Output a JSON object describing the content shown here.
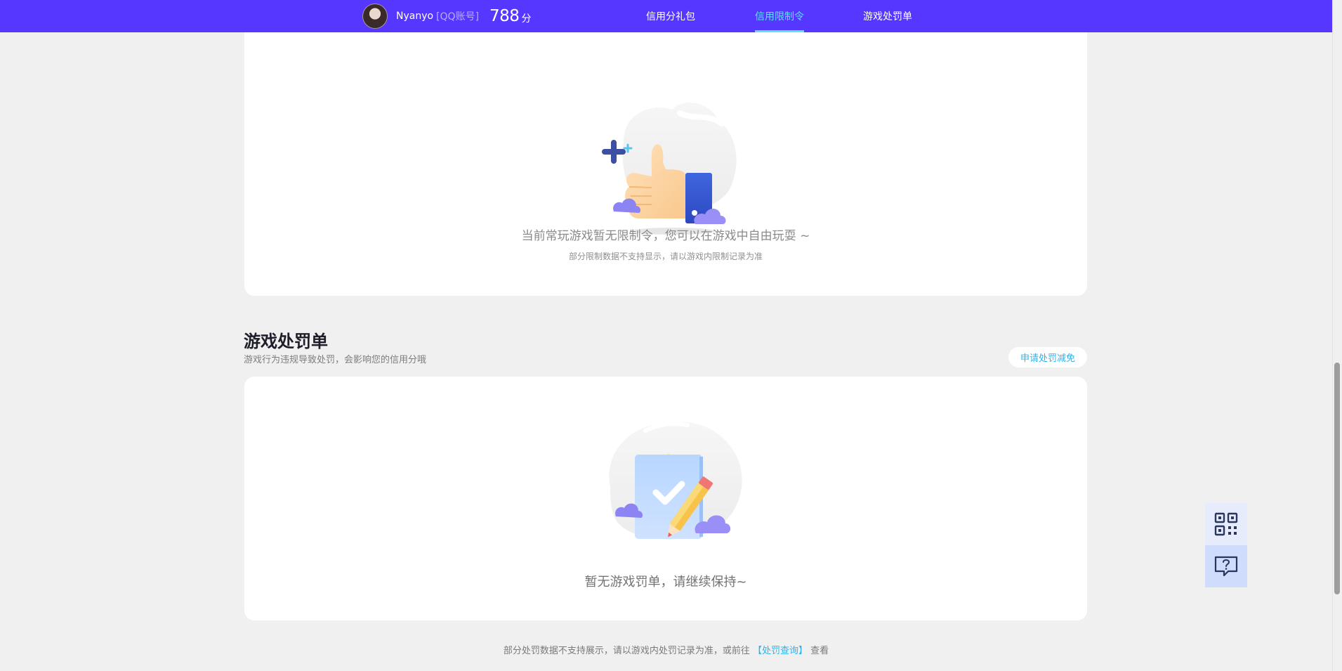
{
  "header": {
    "username": "Nyanyo",
    "account_type": "[QQ账号]",
    "score": "788",
    "score_unit": "分",
    "nav": [
      "信用分礼包",
      "信用限制令",
      "游戏处罚单"
    ],
    "active_nav": "信用限制令",
    "accent": "#5537ff",
    "active_color": "#5fe0ff"
  },
  "restriction": {
    "empty_text": "当前常玩游戏暂无限制令，您可以在游戏中自由玩耍 ~",
    "note": "部分限制数据不支持显示，请以游戏内限制记录为准"
  },
  "penalty": {
    "title": "游戏处罚单",
    "description": "游戏行为违规导致处罚，会影响您的信用分哦",
    "apply_button": "申请处罚减免",
    "empty_text": "暂无游戏罚单，请继续保持~"
  },
  "footer": {
    "text_before": "部分处罚数据不支持展示，请以游戏内处罚记录为准，或前往",
    "link": "【处罚查询】",
    "text_after": "查看",
    "link_color": "#2db3ea"
  },
  "side_buttons": [
    "qr-code-icon",
    "help-chat-icon"
  ]
}
